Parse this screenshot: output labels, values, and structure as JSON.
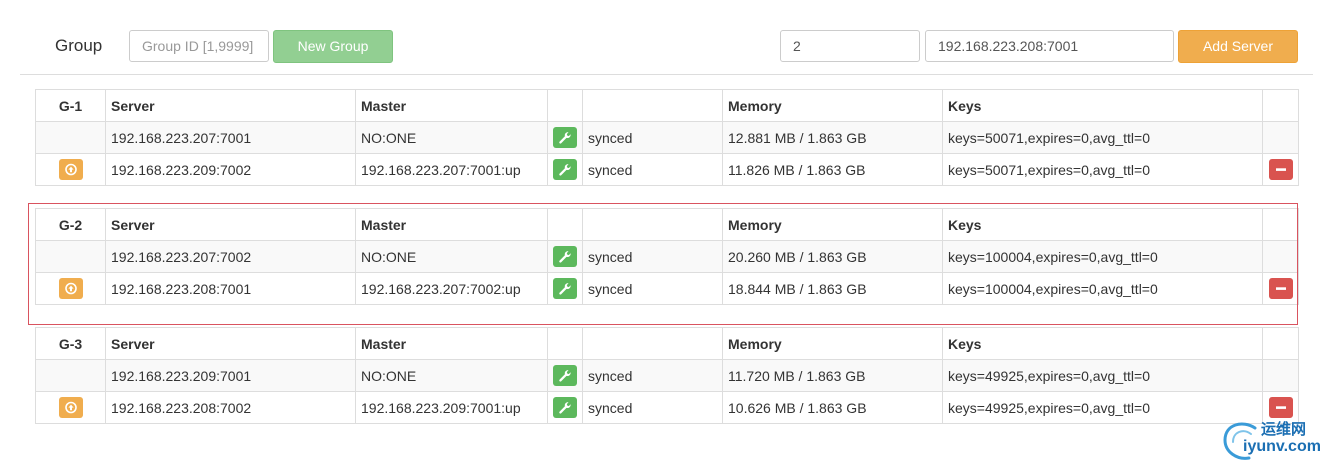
{
  "toolbar": {
    "group_label": "Group",
    "group_id_placeholder": "Group ID [1,9999]",
    "new_group_label": "New Group",
    "server_group_value": "2",
    "server_addr_value": "192.168.223.208:7001",
    "add_server_label": "Add Server"
  },
  "colors": {
    "wrench": "#5cb85c",
    "promote": "#f0ad4e",
    "remove": "#d9534f",
    "highlight_border": "#d9535f",
    "new_group": "#92cf92",
    "add_server": "#f0ad4e"
  },
  "columns": {
    "server": "Server",
    "master": "Master",
    "memory": "Memory",
    "keys": "Keys"
  },
  "groups": [
    {
      "name": "G-1",
      "rows": [
        {
          "server": "192.168.223.207:7001",
          "master": "NO:ONE",
          "status": "synced",
          "memory": "12.881 MB / 1.863 GB",
          "keys": "keys=50071,expires=0,avg_ttl=0"
        },
        {
          "server": "192.168.223.209:7002",
          "master": "192.168.223.207:7001:up",
          "status": "synced",
          "memory": "11.826 MB / 1.863 GB",
          "keys": "keys=50071,expires=0,avg_ttl=0"
        }
      ]
    },
    {
      "name": "G-2",
      "rows": [
        {
          "server": "192.168.223.207:7002",
          "master": "NO:ONE",
          "status": "synced",
          "memory": "20.260 MB / 1.863 GB",
          "keys": "keys=100004,expires=0,avg_ttl=0"
        },
        {
          "server": "192.168.223.208:7001",
          "master": "192.168.223.207:7002:up",
          "status": "synced",
          "memory": "18.844 MB / 1.863 GB",
          "keys": "keys=100004,expires=0,avg_ttl=0"
        }
      ]
    },
    {
      "name": "G-3",
      "rows": [
        {
          "server": "192.168.223.209:7001",
          "master": "NO:ONE",
          "status": "synced",
          "memory": "11.720 MB / 1.863 GB",
          "keys": "keys=49925,expires=0,avg_ttl=0"
        },
        {
          "server": "192.168.223.208:7002",
          "master": "192.168.223.209:7001:up",
          "status": "synced",
          "memory": "10.626 MB / 1.863 GB",
          "keys": "keys=49925,expires=0,avg_ttl=0"
        }
      ]
    }
  ],
  "watermark": {
    "cn": "运维网",
    "en": "iyunv.com"
  }
}
